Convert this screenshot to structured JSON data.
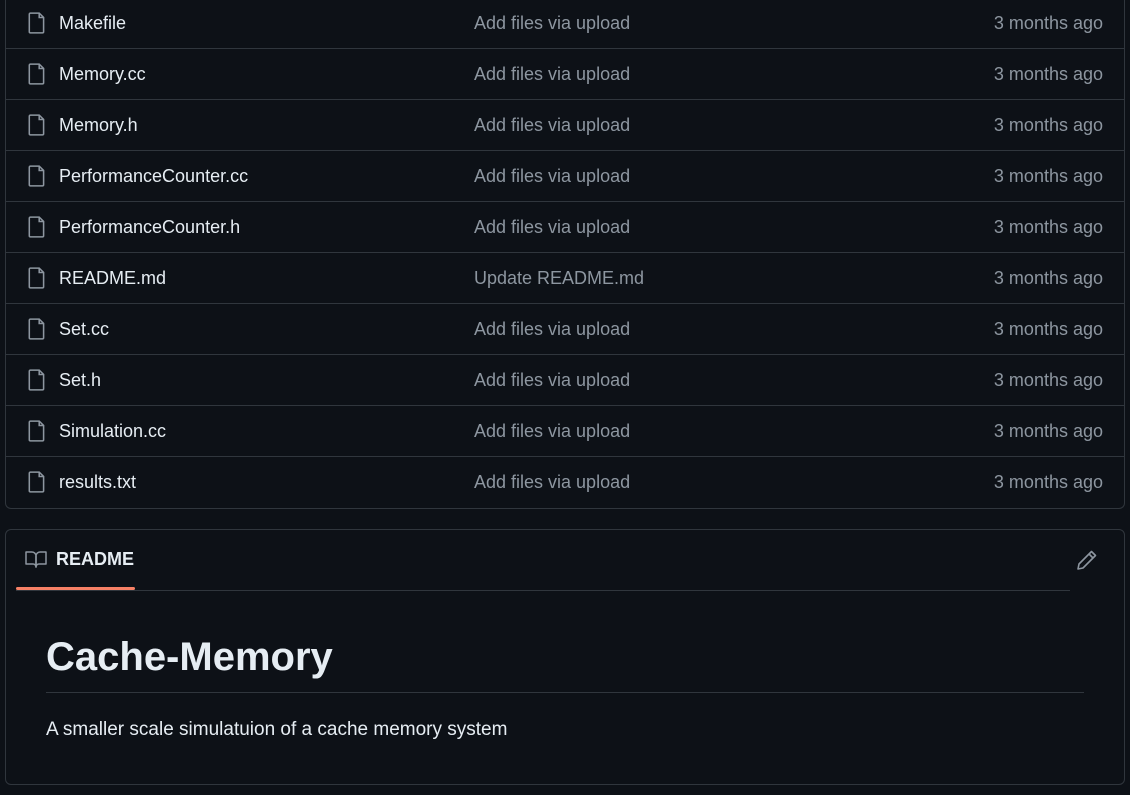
{
  "files": [
    {
      "name": "Makefile",
      "commit": "Add files via upload",
      "age": "3 months ago"
    },
    {
      "name": "Memory.cc",
      "commit": "Add files via upload",
      "age": "3 months ago"
    },
    {
      "name": "Memory.h",
      "commit": "Add files via upload",
      "age": "3 months ago"
    },
    {
      "name": "PerformanceCounter.cc",
      "commit": "Add files via upload",
      "age": "3 months ago"
    },
    {
      "name": "PerformanceCounter.h",
      "commit": "Add files via upload",
      "age": "3 months ago"
    },
    {
      "name": "README.md",
      "commit": "Update README.md",
      "age": "3 months ago"
    },
    {
      "name": "Set.cc",
      "commit": "Add files via upload",
      "age": "3 months ago"
    },
    {
      "name": "Set.h",
      "commit": "Add files via upload",
      "age": "3 months ago"
    },
    {
      "name": "Simulation.cc",
      "commit": "Add files via upload",
      "age": "3 months ago"
    },
    {
      "name": "results.txt",
      "commit": "Add files via upload",
      "age": "3 months ago"
    }
  ],
  "readme": {
    "tab_label": "README",
    "tab_icon": "book-icon",
    "edit_icon": "pencil-icon",
    "title": "Cache-Memory",
    "description": "A smaller scale simulatuion of a cache memory system"
  },
  "colors": {
    "background": "#0d1117",
    "border": "#30363d",
    "text_primary": "#e6edf3",
    "text_muted": "#8d96a0",
    "tab_underline": "#f78166"
  }
}
